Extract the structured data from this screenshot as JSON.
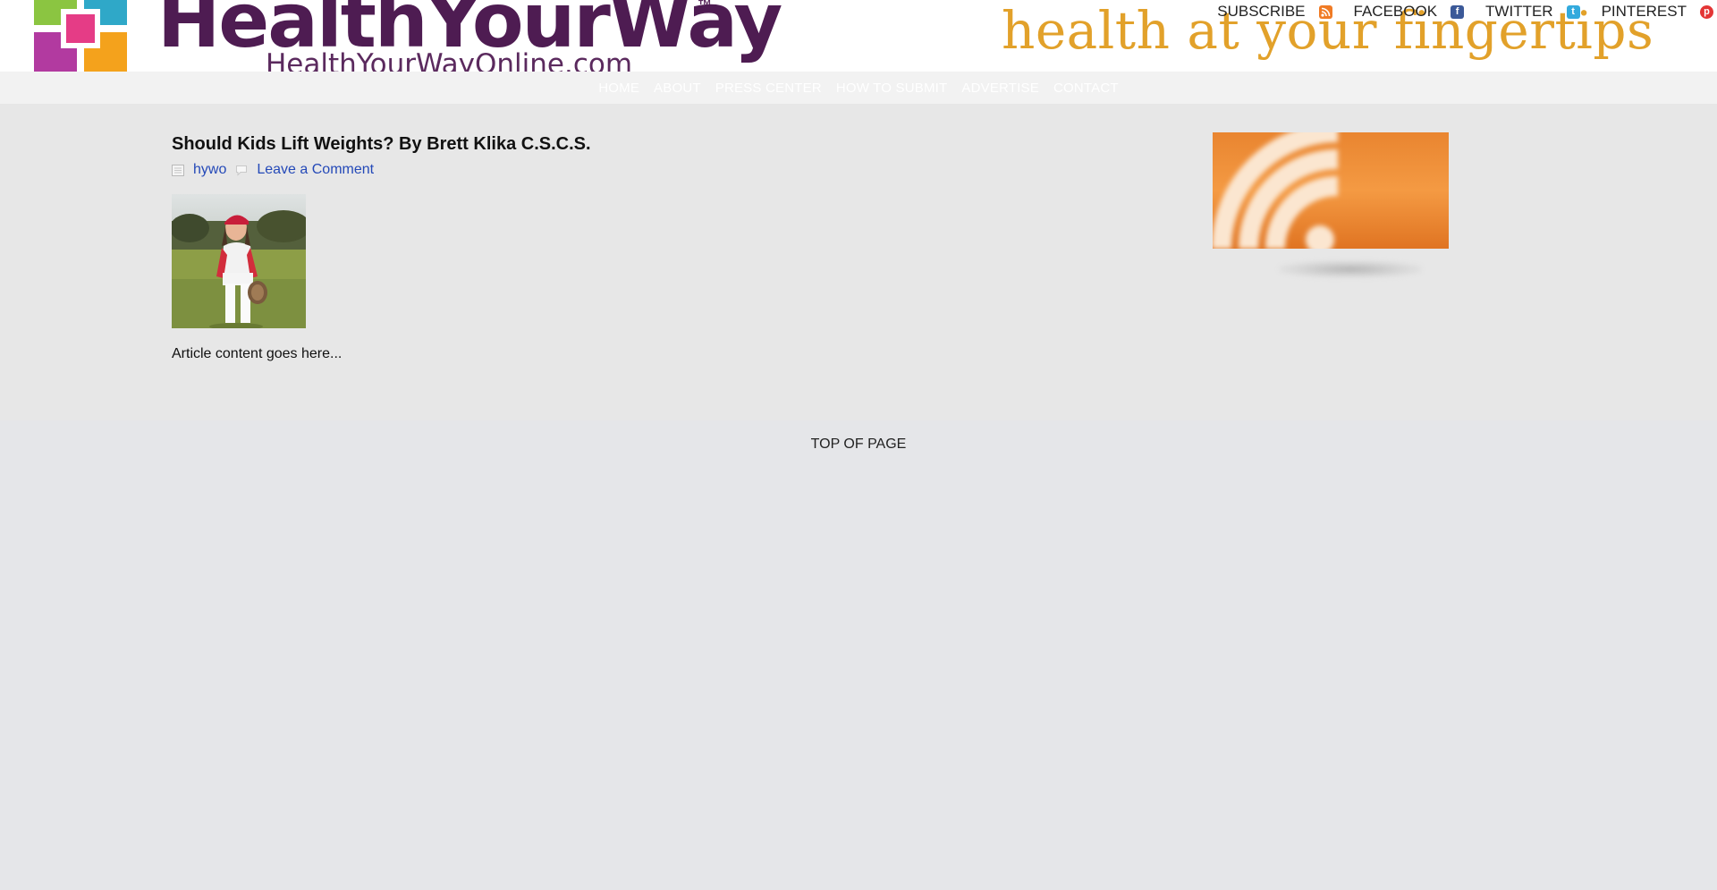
{
  "header": {
    "logo_text": "HealthYourWay",
    "logo_tm": "™",
    "logo_url": "HealthYourWayOnline.com",
    "tagline": "health at your fingertips",
    "social": [
      {
        "label": "SUBSCRIBE",
        "icon": "rss-icon"
      },
      {
        "label": "FACEBOOK",
        "icon": "facebook-icon"
      },
      {
        "label": "TWITTER",
        "icon": "twitter-icon"
      },
      {
        "label": "PINTEREST",
        "icon": "pinterest-icon"
      }
    ]
  },
  "nav": {
    "items": [
      "HOME",
      "ABOUT",
      "PRESS CENTER",
      "HOW TO SUBMIT",
      "ADVERTISE",
      "CONTACT"
    ]
  },
  "article": {
    "title": "Should Kids Lift Weights? By Brett Klika C.S.C.S.",
    "author": "hywo",
    "comment_link": "Leave a Comment",
    "body": "Article content goes here..."
  },
  "footer": {
    "top_link": "TOP OF PAGE"
  },
  "colors": {
    "brand_purple": "#4e1c52",
    "tagline_gold": "#e2a12a",
    "link_blue": "#2449b8",
    "rss_orange": "#f07b25"
  }
}
